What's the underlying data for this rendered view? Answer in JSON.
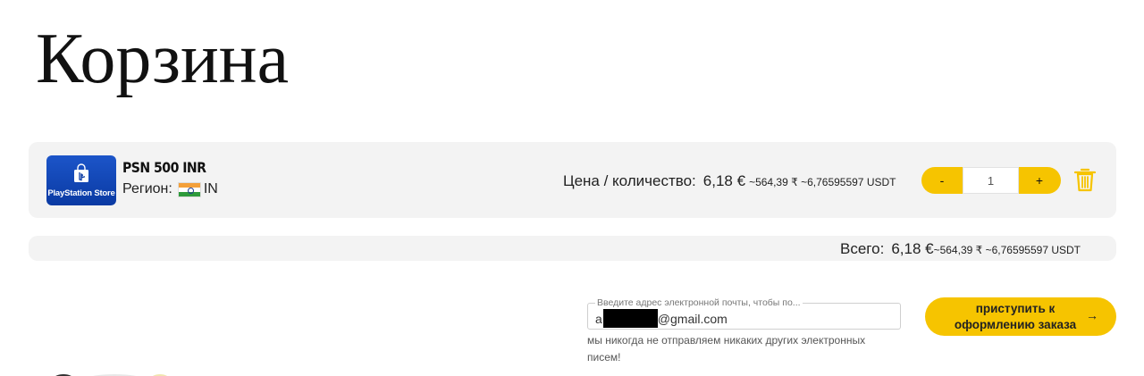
{
  "page": {
    "title": "Корзина"
  },
  "cart_item": {
    "logo_text": "PlayStation Store",
    "name": "PSN 500 INR",
    "region_label": "Регион:",
    "region_code": "IN",
    "price_label": "Цена / количество:",
    "price_eur": "6,18 €",
    "price_alt": "~564,39 ₹ ~6,76595597 USDT",
    "quantity": "1",
    "decrement_label": "-",
    "increment_label": "+"
  },
  "total": {
    "label": "Всего:",
    "eur": "6,18 €",
    "alt": "~564,39 ₹ ~6,76595597 USDT"
  },
  "email": {
    "label": "Введите адрес электронной почты, чтобы по...",
    "value_prefix": "a",
    "value_suffix": "@gmail.com",
    "note": "мы никогда не отправляем никаких других электронных писем!"
  },
  "checkout": {
    "label": "приступить к оформлению заказа",
    "arrow": "→"
  },
  "colors": {
    "accent": "#f6c400",
    "panel_bg": "#f3f3f3",
    "psn_blue": "#0a3aa3",
    "trash": "#f6c400"
  },
  "icons": {
    "logo": "playstation-store-bag-icon",
    "flag": "india-flag-icon",
    "trash": "trash-icon",
    "arrow": "arrow-right-icon"
  }
}
